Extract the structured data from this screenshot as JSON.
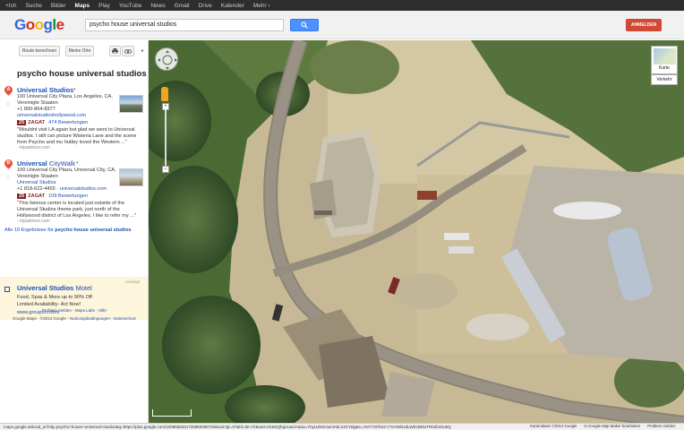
{
  "gbar": {
    "items": [
      "+Ich",
      "Suche",
      "Bilder",
      "Maps",
      "Play",
      "YouTube",
      "News",
      "Gmail",
      "Drive",
      "Kalender",
      "Mehr ›"
    ],
    "active_index": 3
  },
  "header": {
    "logo": "Google",
    "search_value": "psycho house universal studios",
    "signin_label": "ANMELDEN"
  },
  "panel": {
    "route_btn": "Route berechnen",
    "my_places_btn": "Meine Orte",
    "query_title": "psycho house universal studios",
    "results": [
      {
        "marker": "A",
        "title": "Universal Studios",
        "addr1": "100 Universal City Plaza, Los Angeles, CA,",
        "addr2": "Vereinigte Staaten",
        "phone": "+1 800-864-8377",
        "website": "universalstudioshollywood.com",
        "zagat_score": "25",
        "zagat_label": "ZAGAT",
        "reviews": "474 Bewertungen",
        "snippet": "\"Wouldnt visit LA again but glad we went to Universal studios. I still can picture Wisteria Lane and the scene from Psycho and mu hubby loved the Western ...\"",
        "source": "- tripadvisor.com"
      },
      {
        "marker": "B",
        "title_bold": "Universal",
        "title_light": "CityWalk",
        "addr1": "100 Universal City Plaza, Universal City, CA,",
        "addr2": "Vereinigte Staaten",
        "category": "Universal Studios",
        "phone": "+1 818-622-4455",
        "website": "universalstudios.com",
        "zagat_score": "25",
        "zagat_label": "ZAGAT",
        "reviews": "109 Bewertungen",
        "snippet": "\"This famous center is located just outside of the Universal Studios theme park, just north of the Hollywood district of Los Angeles. I like to refer my ...\"",
        "source": "- tripadvisor.com"
      }
    ],
    "all_results_prefix": "Alle 10 Ergebnisse für",
    "all_results_query": "psycho house universal studios",
    "ad": {
      "label": "Anzeige",
      "title_bold": "Universal Studios",
      "title_light": "Motel",
      "line1": "Food, Spas & More up to 90% Off",
      "line2": "Limited Availability- Act Now!",
      "url": "www.groupon.com/"
    },
    "footer_links": "Problem melden - Maps Labs - Hilfe",
    "footer_copy_prefix": "Google Maps - ©2013 Google -",
    "footer_copy_link": "Nutzungsbedingungen - Datenschutz"
  },
  "map": {
    "card_label": "Karte",
    "traffic_label": "Verkehr"
  },
  "statusbar": {
    "url": "maps.google.at/local_url?dq=psycho+house+universal+studios&q=https://plus.google.com/100865842172696259673/about?gl=AT&hl=de-AT&ved=0CB4QhgUoas/A&sa=YbyUZKtCseniAbL24CYBg&s=ANYYN7kSCY7eAWl4vdLWEcBMuTR02b3Xu5Q",
    "imagery": "Kartendaten ©2013 Google",
    "edit_link": "In Google Map Maker bearbeiten",
    "report": "Problem melden"
  },
  "colors": {
    "search_button": "#4d90fe",
    "signin_button": "#d14836",
    "link_blue": "#1a4fb5",
    "zagat_red": "#8b1f1f",
    "ad_background": "#fdf5dc"
  }
}
